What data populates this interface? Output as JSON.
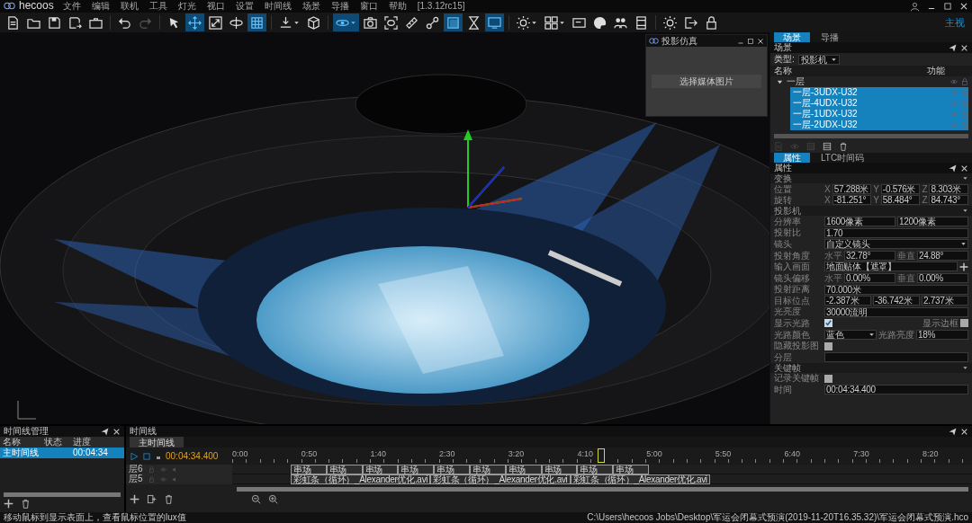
{
  "app": {
    "name": "hecoos",
    "version": "[1.3.12rc15]"
  },
  "menu": [
    "文件",
    "编辑",
    "联机",
    "工具",
    "灯光",
    "视口",
    "设置",
    "时间线",
    "场景",
    "导播",
    "窗口",
    "帮助"
  ],
  "toolbar": [
    [
      {
        "selected": false
      },
      {
        "selected": false
      },
      {
        "selected": false
      },
      {
        "selected": false
      },
      {
        "selected": false
      }
    ],
    [
      {
        "selected": false
      },
      {
        "selected": false,
        "disabled": true
      }
    ],
    [
      {
        "selected": false
      },
      {
        "selected": true
      },
      {
        "selected": false
      },
      {
        "selected": false
      },
      {
        "selected": true
      }
    ],
    [
      {
        "selected": false,
        "dropdown": true
      },
      {
        "selected": false
      }
    ],
    [
      {
        "selected": true,
        "dropdown": true
      },
      {
        "selected": false
      },
      {
        "selected": false
      },
      {
        "selected": false
      },
      {
        "selected": false
      },
      {
        "selected": true
      },
      {
        "selected": false
      },
      {
        "selected": true
      }
    ],
    [
      {
        "selected": false,
        "dropdown": true
      },
      {
        "selected": false,
        "dropdown": true
      },
      {
        "selected": false
      },
      {
        "selected": false
      },
      {
        "selected": false
      },
      {
        "selected": false
      }
    ],
    [
      {
        "selected": false
      },
      {
        "selected": false
      },
      {
        "selected": false
      }
    ]
  ],
  "view_label": "主视",
  "projector_window": {
    "title": "投影仿真",
    "button": "选择媒体图片"
  },
  "scene_panel": {
    "tabs": [
      {
        "label": "场景",
        "selected": true
      },
      {
        "label": "导播",
        "selected": false
      }
    ],
    "title": "场景",
    "type_label": "类型:",
    "type_value": "投影机",
    "columns": [
      "名称",
      "功能"
    ],
    "tree": [
      {
        "label": "一层",
        "expanded": true,
        "selected": false,
        "children": [
          {
            "label": "一层-3UDX-U32",
            "selected": true
          },
          {
            "label": "一层-4UDX-U32",
            "selected": true
          },
          {
            "label": "一层-1UDX-U32",
            "selected": true
          },
          {
            "label": "一层-2UDX-U32",
            "selected": true
          }
        ]
      }
    ],
    "tools": [
      {
        "disabled": true
      },
      {
        "disabled": true
      },
      {
        "disabled": true
      },
      {
        "disabled": false
      },
      {
        "disabled": false
      }
    ]
  },
  "properties_panel": {
    "tabs": [
      {
        "label": "属性",
        "selected": true
      },
      {
        "label": "LTC时间码",
        "selected": false
      }
    ],
    "title": "属性",
    "sections": [
      {
        "title": "变换",
        "rows": [
          {
            "label": "位置",
            "cells": [
              {
                "kind": "prefix",
                "text": "X"
              },
              {
                "kind": "field",
                "value": "57.288米"
              },
              {
                "kind": "prefix",
                "text": "Y"
              },
              {
                "kind": "field",
                "value": "-0.576米"
              },
              {
                "kind": "prefix",
                "text": "Z"
              },
              {
                "kind": "field",
                "value": "8.303米"
              }
            ]
          },
          {
            "label": "旋转",
            "cells": [
              {
                "kind": "prefix",
                "text": "X"
              },
              {
                "kind": "field",
                "value": "-81.251°"
              },
              {
                "kind": "prefix",
                "text": "Y"
              },
              {
                "kind": "field",
                "value": "58.484°"
              },
              {
                "kind": "prefix",
                "text": "Z"
              },
              {
                "kind": "field",
                "value": "84.743°"
              }
            ]
          }
        ]
      },
      {
        "title": "投影机",
        "rows": [
          {
            "label": "分辨率",
            "cells": [
              {
                "kind": "field",
                "value": "1600像素"
              },
              {
                "kind": "field",
                "value": "1200像素"
              }
            ]
          },
          {
            "label": "投射比",
            "cells": [
              {
                "kind": "field",
                "value": "1.70"
              }
            ]
          },
          {
            "label": "镜头",
            "cells": [
              {
                "kind": "select",
                "value": "自定义镜头"
              }
            ]
          },
          {
            "label": "投射角度",
            "cells": [
              {
                "kind": "prefix",
                "text": "水平"
              },
              {
                "kind": "field",
                "value": "32.78°"
              },
              {
                "kind": "prefix",
                "text": "垂直"
              },
              {
                "kind": "field",
                "value": "24.88°"
              }
            ]
          },
          {
            "label": "输入画面",
            "cells": [
              {
                "kind": "field",
                "value": "地面贴体【遮罩】"
              },
              {
                "kind": "add"
              }
            ]
          },
          {
            "label": "镜头偏移",
            "cells": [
              {
                "kind": "prefix",
                "text": "水平"
              },
              {
                "kind": "field",
                "value": "0.00%"
              },
              {
                "kind": "prefix",
                "text": "垂直"
              },
              {
                "kind": "field",
                "value": "0.00%"
              }
            ]
          },
          {
            "label": "投射距离",
            "cells": [
              {
                "kind": "field",
                "value": "70.000米"
              }
            ]
          },
          {
            "label": "目标位点",
            "cells": [
              {
                "kind": "field",
                "value": "-2.387米"
              },
              {
                "kind": "field",
                "value": "-36.742米"
              },
              {
                "kind": "field",
                "value": "2.737米"
              }
            ]
          },
          {
            "label": "光亮度",
            "cells": [
              {
                "kind": "field",
                "value": "30000流明"
              }
            ]
          },
          {
            "label": "显示光路",
            "cells": [
              {
                "kind": "check",
                "checked": true
              },
              {
                "kind": "label",
                "text": "显示边框"
              },
              {
                "kind": "check",
                "checked": false
              }
            ]
          },
          {
            "label": "光路颜色",
            "cells": [
              {
                "kind": "select",
                "value": "蓝色"
              },
              {
                "kind": "label",
                "text": "光路亮度"
              },
              {
                "kind": "field",
                "value": "18%"
              }
            ]
          },
          {
            "label": "隐藏投影图",
            "cells": [
              {
                "kind": "check",
                "checked": false
              }
            ]
          },
          {
            "label": "分层",
            "cells": [
              {
                "kind": "field"
              }
            ]
          }
        ]
      },
      {
        "title": "关键帧",
        "rows": [
          {
            "label": "记录关键帧",
            "cells": [
              {
                "kind": "check",
                "checked": false
              }
            ]
          },
          {
            "label": "时间",
            "cells": [
              {
                "kind": "spin",
                "value": "00:04:34.400"
              }
            ]
          }
        ]
      }
    ]
  },
  "timeline_manager": {
    "title": "时间线管理",
    "columns": [
      "名称",
      "状态",
      "进度"
    ],
    "rows": [
      {
        "name": "主时间线",
        "progress": "00:04:34",
        "selected": true
      }
    ]
  },
  "timeline": {
    "title": "时间线",
    "tabs": [
      {
        "label": "主时间线",
        "selected": true
      }
    ],
    "time": "00:04:34.400",
    "ruler": [
      "0:00",
      "0:50",
      "1:40",
      "2:30",
      "3:20",
      "4:10",
      "5:00",
      "5:50",
      "6:40",
      "7:30",
      "8:20"
    ],
    "layers": [
      {
        "name": "层6",
        "clips": [
          "串场",
          "串场",
          "串场",
          "串场",
          "串场",
          "串场",
          "串场",
          "串场",
          "串场",
          "串场"
        ]
      },
      {
        "name": "层5",
        "clips": [
          "彩虹条（循环）_Alexander优化.avi",
          "彩虹条（循环）_Alexander优化.avi",
          "彩虹条（循环）_Alexander优化.avi"
        ]
      }
    ]
  },
  "status_bar": {
    "hint": "移动鼠标到显示表面上，查看鼠标位置的lux值",
    "path": "C:\\Users\\hecoos Jobs\\Desktop\\军运会闭幕式预演(2019-11-20T16.35.32)\\军运会闭幕式预演.hco"
  }
}
